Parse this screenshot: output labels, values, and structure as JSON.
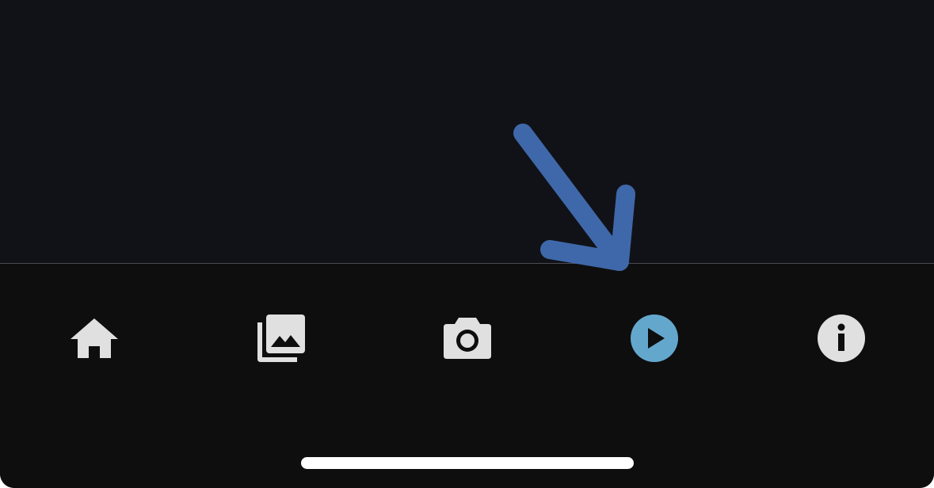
{
  "tab_bar": {
    "items": [
      {
        "id": "home",
        "icon": "home-icon",
        "active": false
      },
      {
        "id": "photos",
        "icon": "photo-library-icon",
        "active": false
      },
      {
        "id": "camera",
        "icon": "camera-icon",
        "active": false
      },
      {
        "id": "play",
        "icon": "play-circle-icon",
        "active": true
      },
      {
        "id": "info",
        "icon": "info-circle-icon",
        "active": false
      }
    ]
  },
  "colors": {
    "content_background": "#111218",
    "tab_bar_background": "#0e0e0e",
    "icon_default": "#e0e0e0",
    "icon_active": "#64a7cd",
    "annotation_arrow": "#3f68aa",
    "home_indicator": "#ffffff"
  },
  "annotation": {
    "icon": "arrow-annotation",
    "points_to": "play"
  }
}
